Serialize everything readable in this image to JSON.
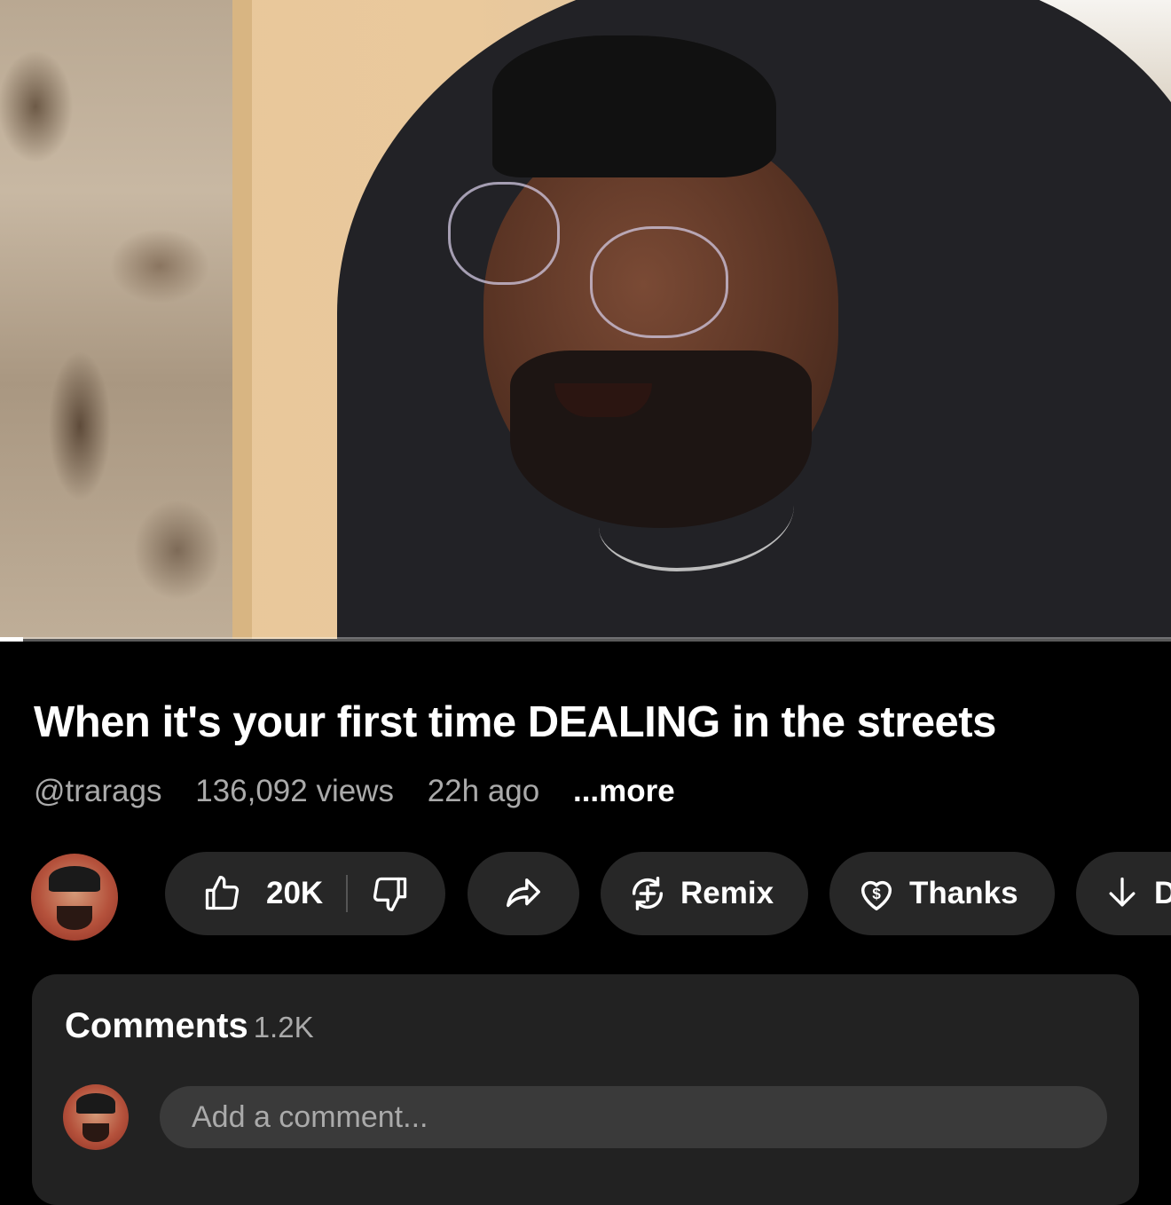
{
  "video": {
    "progress_fraction": 0.02
  },
  "title": "When it's your first time DEALING in the streets",
  "meta": {
    "channel": "@trarags",
    "views": "136,092 views",
    "age": "22h ago",
    "more": "...more"
  },
  "actions": {
    "likes": "20K",
    "remix": "Remix",
    "thanks": "Thanks",
    "download": "D"
  },
  "comments": {
    "heading": "Comments",
    "count": "1.2K",
    "placeholder": "Add a comment..."
  },
  "icons": {
    "like": "thumbs-up-icon",
    "dislike": "thumbs-down-icon",
    "share": "share-arrow-icon",
    "remix": "remix-icon",
    "thanks": "heart-dollar-icon",
    "download": "download-arrow-icon"
  },
  "colors": {
    "background": "#000000",
    "pill": "#272727",
    "card": "#222222",
    "secondary_text": "#aaaaaa"
  }
}
